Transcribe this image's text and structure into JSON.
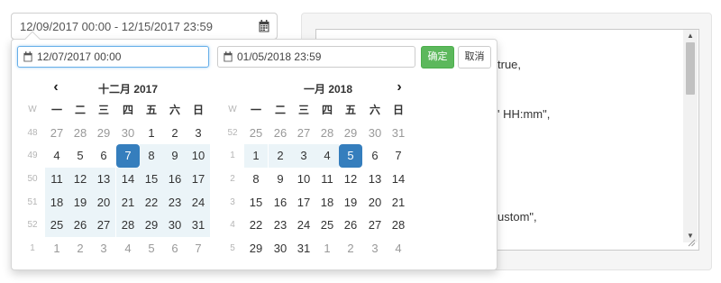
{
  "main_input": {
    "value": "12/09/2017 00:00 - 12/15/2017 23:59",
    "icon": "calendar-icon"
  },
  "editor": {
    "fragments": [
      "true,",
      "' HH:mm\",",
      "ustom\","
    ]
  },
  "picker": {
    "start_field": {
      "value": "12/07/2017 00:00",
      "icon": "calendar-icon"
    },
    "end_field": {
      "value": "01/05/2018 23:59",
      "icon": "calendar-icon"
    },
    "ok_label": "确定",
    "cancel_label": "取消",
    "colors": {
      "ok": "#5cb85c",
      "active": "#357ebd",
      "in_range": "#ebf4f8",
      "focus": "#66afe9"
    },
    "calendars": [
      {
        "title": "十二月 2017",
        "week_label": "W",
        "weekdays": [
          "一",
          "二",
          "三",
          "四",
          "五",
          "六",
          "日"
        ],
        "weeks": [
          {
            "num": "48",
            "days": [
              {
                "d": "27",
                "s": "off"
              },
              {
                "d": "28",
                "s": "off"
              },
              {
                "d": "29",
                "s": "off"
              },
              {
                "d": "30",
                "s": "off"
              },
              {
                "d": "1"
              },
              {
                "d": "2"
              },
              {
                "d": "3"
              }
            ]
          },
          {
            "num": "49",
            "days": [
              {
                "d": "4"
              },
              {
                "d": "5"
              },
              {
                "d": "6"
              },
              {
                "d": "7",
                "s": "active"
              },
              {
                "d": "8",
                "s": "in"
              },
              {
                "d": "9",
                "s": "in"
              },
              {
                "d": "10",
                "s": "in"
              }
            ]
          },
          {
            "num": "50",
            "days": [
              {
                "d": "11",
                "s": "in"
              },
              {
                "d": "12",
                "s": "in"
              },
              {
                "d": "13",
                "s": "in"
              },
              {
                "d": "14",
                "s": "in"
              },
              {
                "d": "15",
                "s": "in"
              },
              {
                "d": "16",
                "s": "in"
              },
              {
                "d": "17",
                "s": "in"
              }
            ]
          },
          {
            "num": "51",
            "days": [
              {
                "d": "18",
                "s": "in"
              },
              {
                "d": "19",
                "s": "in"
              },
              {
                "d": "20",
                "s": "in"
              },
              {
                "d": "21",
                "s": "in"
              },
              {
                "d": "22",
                "s": "in"
              },
              {
                "d": "23",
                "s": "in"
              },
              {
                "d": "24",
                "s": "in"
              }
            ]
          },
          {
            "num": "52",
            "days": [
              {
                "d": "25",
                "s": "in"
              },
              {
                "d": "26",
                "s": "in"
              },
              {
                "d": "27",
                "s": "in"
              },
              {
                "d": "28",
                "s": "in"
              },
              {
                "d": "29",
                "s": "in"
              },
              {
                "d": "30",
                "s": "in"
              },
              {
                "d": "31",
                "s": "in"
              }
            ]
          },
          {
            "num": "1",
            "days": [
              {
                "d": "1",
                "s": "off"
              },
              {
                "d": "2",
                "s": "off"
              },
              {
                "d": "3",
                "s": "off"
              },
              {
                "d": "4",
                "s": "off"
              },
              {
                "d": "5",
                "s": "off"
              },
              {
                "d": "6",
                "s": "off"
              },
              {
                "d": "7",
                "s": "off"
              }
            ]
          }
        ]
      },
      {
        "title": "一月 2018",
        "week_label": "W",
        "weekdays": [
          "一",
          "二",
          "三",
          "四",
          "五",
          "六",
          "日"
        ],
        "weeks": [
          {
            "num": "52",
            "days": [
              {
                "d": "25",
                "s": "off"
              },
              {
                "d": "26",
                "s": "off"
              },
              {
                "d": "27",
                "s": "off"
              },
              {
                "d": "28",
                "s": "off"
              },
              {
                "d": "29",
                "s": "off"
              },
              {
                "d": "30",
                "s": "off"
              },
              {
                "d": "31",
                "s": "off"
              }
            ]
          },
          {
            "num": "1",
            "days": [
              {
                "d": "1",
                "s": "in"
              },
              {
                "d": "2",
                "s": "in"
              },
              {
                "d": "3",
                "s": "in"
              },
              {
                "d": "4",
                "s": "in"
              },
              {
                "d": "5",
                "s": "active"
              },
              {
                "d": "6"
              },
              {
                "d": "7"
              }
            ]
          },
          {
            "num": "2",
            "days": [
              {
                "d": "8"
              },
              {
                "d": "9"
              },
              {
                "d": "10"
              },
              {
                "d": "11"
              },
              {
                "d": "12"
              },
              {
                "d": "13"
              },
              {
                "d": "14"
              }
            ]
          },
          {
            "num": "3",
            "days": [
              {
                "d": "15"
              },
              {
                "d": "16"
              },
              {
                "d": "17"
              },
              {
                "d": "18"
              },
              {
                "d": "19"
              },
              {
                "d": "20"
              },
              {
                "d": "21"
              }
            ]
          },
          {
            "num": "4",
            "days": [
              {
                "d": "22"
              },
              {
                "d": "23"
              },
              {
                "d": "24"
              },
              {
                "d": "25"
              },
              {
                "d": "26"
              },
              {
                "d": "27"
              },
              {
                "d": "28"
              }
            ]
          },
          {
            "num": "5",
            "days": [
              {
                "d": "29"
              },
              {
                "d": "30"
              },
              {
                "d": "31"
              },
              {
                "d": "1",
                "s": "off"
              },
              {
                "d": "2",
                "s": "off"
              },
              {
                "d": "3",
                "s": "off"
              },
              {
                "d": "4",
                "s": "off"
              }
            ]
          }
        ]
      }
    ]
  }
}
